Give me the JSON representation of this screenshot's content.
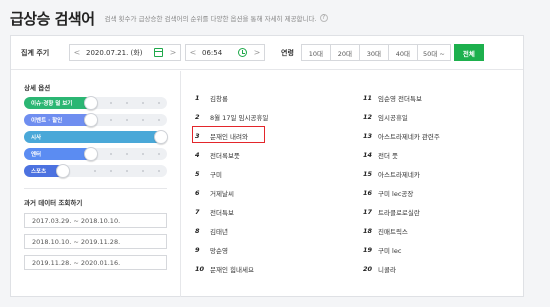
{
  "header": {
    "title": "급상승 검색어",
    "description": "검색 횟수가 급상승한 검색어의 순위를 다양한 옵션을 통해 자세히 제공합니다."
  },
  "filters": {
    "label": "집계 주기",
    "date": "2020.07.21. (화)",
    "time": "06:54",
    "age_label": "연령",
    "ages": [
      "10대",
      "20대",
      "30대",
      "40대",
      "50대 ~"
    ],
    "all_label": "전체",
    "prev_arrow": "<",
    "next_arrow": ">"
  },
  "options": {
    "title": "상세 옵션",
    "toggles": [
      {
        "label": "이슈·경향 덜 보기",
        "color": "#2bb673"
      },
      {
        "label": "이벤트 · 할인",
        "color": "#6f8ef0"
      },
      {
        "label": "시사",
        "color": "#4aa8d8"
      },
      {
        "label": "엔터",
        "color": "#5b8cf2"
      },
      {
        "label": "스포츠",
        "color": "#4c72e0"
      }
    ]
  },
  "past_data": {
    "title": "과거 데이터 조회하기",
    "ranges": [
      "2017.03.29. ~ 2018.10.10.",
      "2018.10.10. ~ 2019.11.28.",
      "2019.11.28. ~ 2020.01.16."
    ]
  },
  "rankings": {
    "left": [
      {
        "rank": "1",
        "keyword": "김창룡"
      },
      {
        "rank": "2",
        "keyword": "8월 17일 임시공휴일"
      },
      {
        "rank": "3",
        "keyword": "문재인 내려와"
      },
      {
        "rank": "4",
        "keyword": "전더록보풋"
      },
      {
        "rank": "5",
        "keyword": "구미"
      },
      {
        "rank": "6",
        "keyword": "거제날씨"
      },
      {
        "rank": "7",
        "keyword": "전더특보"
      },
      {
        "rank": "8",
        "keyword": "김태년"
      },
      {
        "rank": "9",
        "keyword": "망순영"
      },
      {
        "rank": "10",
        "keyword": "문재인 힘내세요"
      }
    ],
    "right": [
      {
        "rank": "11",
        "keyword": "임순영 전더특보"
      },
      {
        "rank": "12",
        "keyword": "임시공휴일"
      },
      {
        "rank": "13",
        "keyword": "아스트라제네카 관련주"
      },
      {
        "rank": "14",
        "keyword": "전더 풋"
      },
      {
        "rank": "15",
        "keyword": "아스트라제네카"
      },
      {
        "rank": "16",
        "keyword": "구미 lec공장"
      },
      {
        "rank": "17",
        "keyword": "트라클로로실란"
      },
      {
        "rank": "18",
        "keyword": "진매트릭스"
      },
      {
        "rank": "19",
        "keyword": "구미 lec"
      },
      {
        "rank": "20",
        "keyword": "니콜라"
      }
    ]
  }
}
